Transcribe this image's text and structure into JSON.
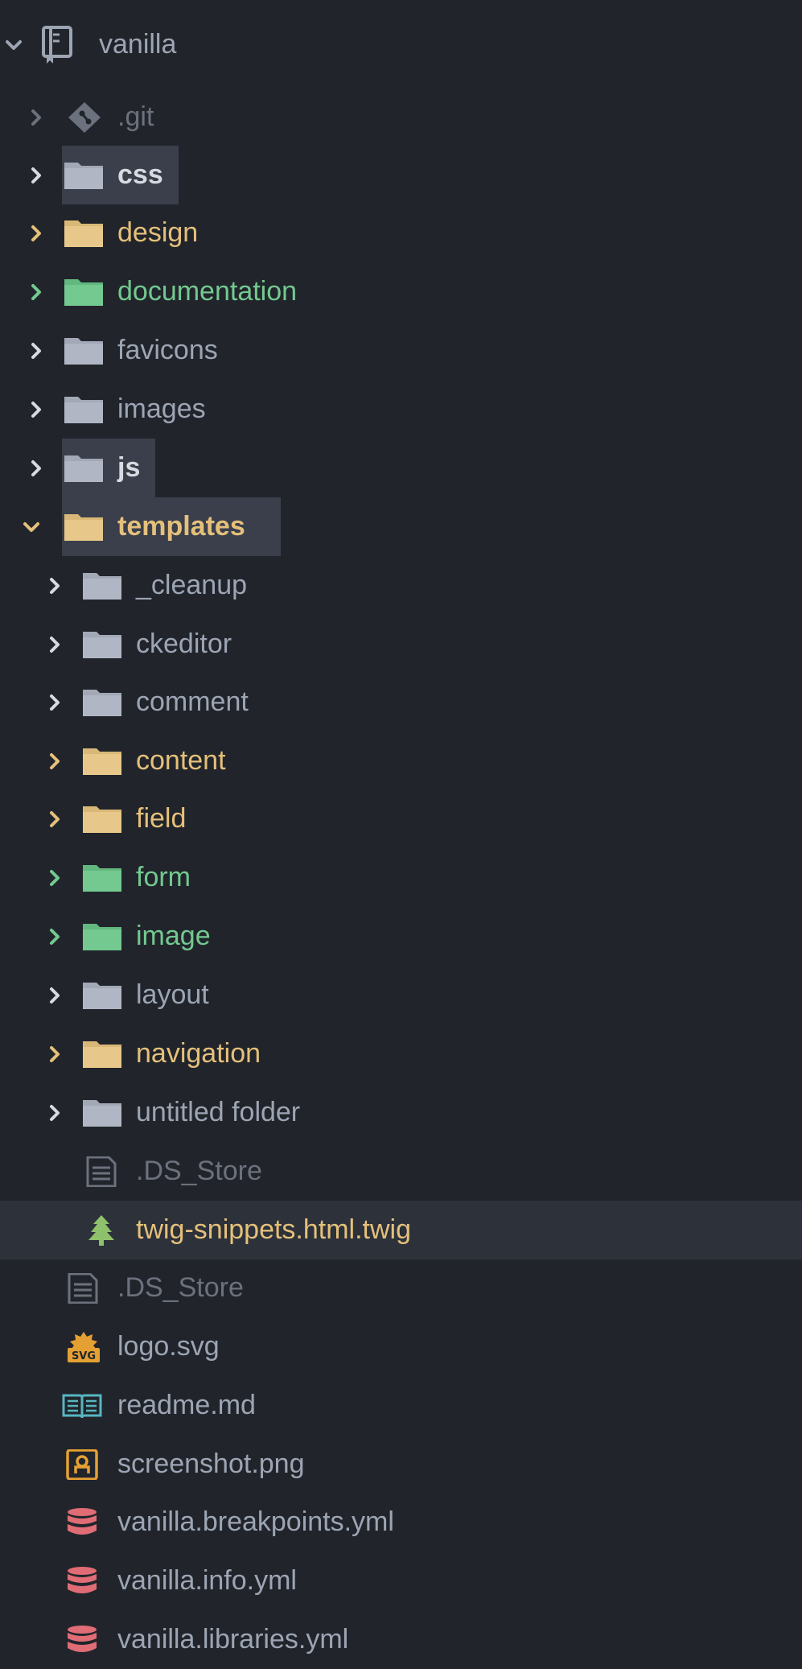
{
  "project": {
    "name": "vanilla",
    "icon": "repo-icon"
  },
  "colors": {
    "background": "#21252b",
    "selected_row": "#2c313a",
    "highlight": "#3a3f4b",
    "default_text": "#9da5b4",
    "ignored_text": "#6b717d",
    "modified": "#e5c07b",
    "added": "#73c990"
  },
  "tree": [
    {
      "label": ".git",
      "type": "folder",
      "icon": "git-icon",
      "state": "ignored"
    },
    {
      "label": "css",
      "type": "folder",
      "icon": "folder-icon",
      "state": "default"
    },
    {
      "label": "design",
      "type": "folder",
      "icon": "folder-icon",
      "state": "modified"
    },
    {
      "label": "documentation",
      "type": "folder",
      "icon": "folder-icon",
      "state": "added"
    },
    {
      "label": "favicons",
      "type": "folder",
      "icon": "folder-icon",
      "state": "default"
    },
    {
      "label": "images",
      "type": "folder",
      "icon": "folder-icon",
      "state": "default"
    },
    {
      "label": "js",
      "type": "folder",
      "icon": "folder-icon",
      "state": "default"
    },
    {
      "label": "templates",
      "type": "folder",
      "icon": "folder-icon",
      "state": "modified",
      "expanded": true
    },
    {
      "label": "_cleanup",
      "type": "folder",
      "icon": "folder-icon",
      "state": "default"
    },
    {
      "label": "ckeditor",
      "type": "folder",
      "icon": "folder-icon",
      "state": "default"
    },
    {
      "label": "comment",
      "type": "folder",
      "icon": "folder-icon",
      "state": "default"
    },
    {
      "label": "content",
      "type": "folder",
      "icon": "folder-icon",
      "state": "modified"
    },
    {
      "label": "field",
      "type": "folder",
      "icon": "folder-icon",
      "state": "modified"
    },
    {
      "label": "form",
      "type": "folder",
      "icon": "folder-icon",
      "state": "added"
    },
    {
      "label": "image",
      "type": "folder",
      "icon": "folder-icon",
      "state": "added"
    },
    {
      "label": "layout",
      "type": "folder",
      "icon": "folder-icon",
      "state": "default"
    },
    {
      "label": "navigation",
      "type": "folder",
      "icon": "folder-icon",
      "state": "modified"
    },
    {
      "label": "untitled folder",
      "type": "folder",
      "icon": "folder-icon",
      "state": "default"
    },
    {
      "label": ".DS_Store",
      "type": "file",
      "icon": "file-text-icon",
      "state": "ignored"
    },
    {
      "label": "twig-snippets.html.twig",
      "type": "file",
      "icon": "twig-tree-icon",
      "state": "modified",
      "selected": true
    },
    {
      "label": ".DS_Store",
      "type": "file",
      "icon": "file-text-icon",
      "state": "ignored"
    },
    {
      "label": "logo.svg",
      "type": "file",
      "icon": "svg-icon",
      "state": "default"
    },
    {
      "label": "readme.md",
      "type": "file",
      "icon": "book-icon",
      "state": "default"
    },
    {
      "label": "screenshot.png",
      "type": "file",
      "icon": "image-icon",
      "state": "default"
    },
    {
      "label": "vanilla.breakpoints.yml",
      "type": "file",
      "icon": "database-icon",
      "state": "default"
    },
    {
      "label": "vanilla.info.yml",
      "type": "file",
      "icon": "database-icon",
      "state": "default"
    },
    {
      "label": "vanilla.libraries.yml",
      "type": "file",
      "icon": "database-icon",
      "state": "default"
    }
  ]
}
